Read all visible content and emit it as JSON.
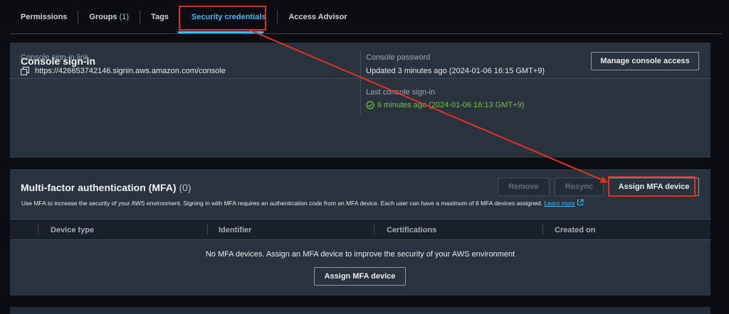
{
  "tabs": [
    {
      "label": "Permissions",
      "count": ""
    },
    {
      "label": "Groups",
      "count": "(1)"
    },
    {
      "label": "Tags",
      "count": ""
    },
    {
      "label": "Security credentials",
      "count": ""
    },
    {
      "label": "Access Advisor",
      "count": ""
    }
  ],
  "console_signin": {
    "title": "Console sign-in",
    "manage_button": "Manage console access",
    "link_label": "Console sign-in link",
    "link_value": "https://426653742146.signin.aws.amazon.com/console",
    "password_label": "Console password",
    "password_value": "Updated 3 minutes ago (2024-01-06 16:15 GMT+9)",
    "last_signin_label": "Last console sign-in",
    "last_signin_value": "6 minutes ago (2024-01-06 16:13 GMT+9)"
  },
  "mfa": {
    "title": "Multi-factor authentication (MFA)",
    "count": "(0)",
    "remove_button": "Remove",
    "resync_button": "Resync",
    "assign_button": "Assign MFA device",
    "description": "Use MFA to increase the security of your AWS environment. Signing in with MFA requires an authentication code from an MFA device. Each user can have a maximum of 8 MFA devices assigned.",
    "learn_more": "Learn more",
    "columns": [
      "Device type",
      "Identifier",
      "Certifications",
      "Created on"
    ],
    "empty_message": "No MFA devices. Assign an MFA device to improve the security of your AWS environment",
    "empty_assign_button": "Assign MFA device"
  },
  "colors": {
    "accent": "#42b8f7",
    "highlight": "#e0331f",
    "success": "#6fc24a"
  }
}
